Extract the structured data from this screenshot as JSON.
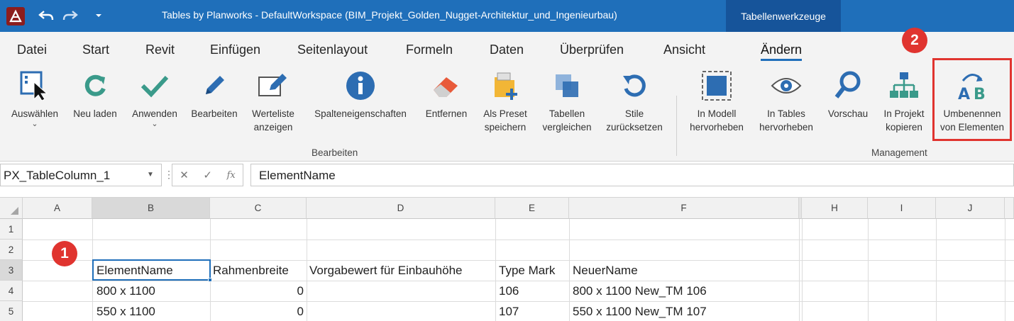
{
  "titlebar": {
    "title": "Tables by Planworks - DefaultWorkspace  (BIM_Projekt_Golden_Nugget-Architektur_und_Ingenieurbau)",
    "contextual_tab": "Tabellenwerkzeuge"
  },
  "menu": {
    "tabs": [
      "Datei",
      "Start",
      "Revit",
      "Einfügen",
      "Seitenlayout",
      "Formeln",
      "Daten",
      "Überprüfen",
      "Ansicht",
      "Ändern"
    ],
    "active": "Ändern"
  },
  "ribbon": {
    "bearbeiten": {
      "label": "Bearbeiten",
      "auswaehlen": "Auswählen",
      "neu_laden": "Neu laden",
      "anwenden": "Anwenden",
      "bearbeiten_btn": "Bearbeiten",
      "werteliste_1": "Werteliste",
      "werteliste_2": "anzeigen",
      "spalten": "Spalteneigenschaften",
      "entfernen": "Entfernen",
      "preset_1": "Als Preset",
      "preset_2": "speichern",
      "tabellen_1": "Tabellen",
      "tabellen_2": "vergleichen",
      "stile_1": "Stile",
      "stile_2": "zurücksetzen"
    },
    "management": {
      "label": "Management",
      "modell_1": "In Modell",
      "modell_2": "hervorheben",
      "tables_1": "In Tables",
      "tables_2": "hervorheben",
      "vorschau": "Vorschau",
      "projekt_1": "In Projekt",
      "projekt_2": "kopieren",
      "umbenennen_1": "Umbenennen",
      "umbenennen_2": "von Elementen"
    },
    "accent_color": "#1f6fba",
    "highlight_color": "#e0342f"
  },
  "annotations": {
    "badge_1": "1",
    "badge_2": "2"
  },
  "formula_bar": {
    "name_box": "PX_TableColumn_1",
    "value": "ElementName"
  },
  "sheet": {
    "columns": [
      "A",
      "B",
      "C",
      "D",
      "E",
      "F",
      "H",
      "I",
      "J"
    ],
    "rows": [
      "1",
      "2",
      "3",
      "4",
      "5"
    ],
    "headers": {
      "b": "ElementName",
      "c": "Rahmenbreite",
      "d": "Vorgabewert für Einbauhöhe",
      "e": "Type Mark",
      "f": "NeuerName"
    },
    "data": [
      {
        "b": "800 x 1100",
        "c": "0",
        "e": "106",
        "f": "800 x 1100 New_TM 106"
      },
      {
        "b": "550 x 1100",
        "c": "0",
        "e": "107",
        "f": "550 x 1100 New_TM 107"
      }
    ]
  }
}
